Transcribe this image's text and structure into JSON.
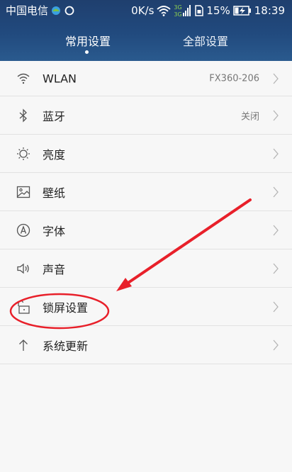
{
  "status_bar": {
    "carrier": "中国电信",
    "speed": "0K/s",
    "network_3g_top": "3G",
    "network_3g_bottom": "3G",
    "battery": "15%",
    "time": "18:39"
  },
  "tabs": [
    {
      "label": "常用设置",
      "active": true
    },
    {
      "label": "全部设置",
      "active": false
    }
  ],
  "settings": [
    {
      "label": "WLAN",
      "value": "FX360-206",
      "icon": "wifi-icon"
    },
    {
      "label": "蓝牙",
      "value": "关闭",
      "icon": "bluetooth-icon"
    },
    {
      "label": "亮度",
      "value": "",
      "icon": "brightness-icon"
    },
    {
      "label": "壁纸",
      "value": "",
      "icon": "wallpaper-icon"
    },
    {
      "label": "字体",
      "value": "",
      "icon": "font-icon"
    },
    {
      "label": "声音",
      "value": "",
      "icon": "sound-icon"
    },
    {
      "label": "锁屏设置",
      "value": "",
      "icon": "lock-icon"
    },
    {
      "label": "系统更新",
      "value": "",
      "icon": "update-arrow-icon"
    }
  ],
  "colors": {
    "header": "#214a7e",
    "annotation_red": "#e8202a",
    "icon_gray": "#555555"
  }
}
